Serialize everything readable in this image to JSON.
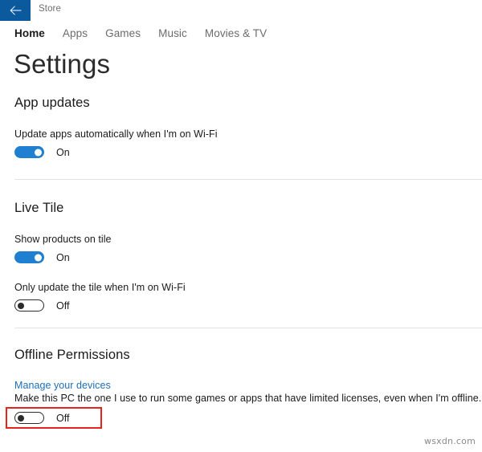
{
  "titlebar": {
    "back_icon": "arrow-left-icon",
    "app_title": "Store",
    "back_bg": "#0c5a9e"
  },
  "tabs": [
    {
      "label": "Home",
      "selected": true
    },
    {
      "label": "Apps",
      "selected": false
    },
    {
      "label": "Games",
      "selected": false
    },
    {
      "label": "Music",
      "selected": false
    },
    {
      "label": "Movies & TV",
      "selected": false
    }
  ],
  "page": {
    "title": "Settings"
  },
  "sections": [
    {
      "heading": "App updates",
      "settings": [
        {
          "label": "Update apps automatically when I'm on Wi-Fi",
          "toggle_state": "On",
          "toggle_on": true
        }
      ]
    },
    {
      "heading": "Live Tile",
      "settings": [
        {
          "label": "Show products on tile",
          "toggle_state": "On",
          "toggle_on": true
        },
        {
          "label": "Only update the tile when I'm on Wi-Fi",
          "toggle_state": "Off",
          "toggle_on": false
        }
      ]
    },
    {
      "heading": "Offline Permissions",
      "link_label": "Manage your devices",
      "description": "Make this PC the one I use to run some games or apps that have limited licenses, even when I'm offline.",
      "settings": [
        {
          "label": "",
          "toggle_state": "Off",
          "toggle_on": false
        }
      ]
    }
  ],
  "colors": {
    "accent": "#1f7fd0",
    "titlebar": "#0c5a9e",
    "link": "#1d6fb8",
    "highlight": "#e8231f",
    "divider": "#e3e3e3"
  },
  "watermark": "wsxdn.com"
}
